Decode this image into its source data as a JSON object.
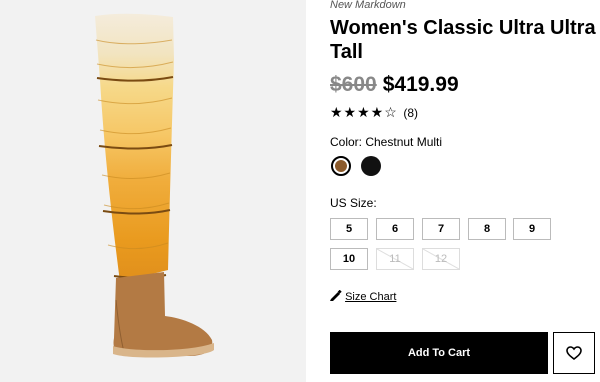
{
  "product": {
    "badge": "New Markdown",
    "title": "Women's Classic Ultra Ultra Tall",
    "price_original": "$600",
    "price_sale": "$419.99",
    "rating": 4,
    "rating_max": 5,
    "stars_display": "★★★★☆",
    "review_count": "(8)"
  },
  "colors": {
    "label": "Color: Chestnut Multi",
    "options": [
      {
        "name": "Chestnut Multi",
        "hex": "#8b5a2b",
        "selected": true
      },
      {
        "name": "Black",
        "hex": "#111111",
        "selected": false
      }
    ]
  },
  "sizes": {
    "label": "US Size:",
    "options": [
      {
        "label": "5",
        "available": true
      },
      {
        "label": "6",
        "available": true
      },
      {
        "label": "7",
        "available": true
      },
      {
        "label": "8",
        "available": true
      },
      {
        "label": "9",
        "available": true
      },
      {
        "label": "10",
        "available": true
      },
      {
        "label": "11",
        "available": false
      },
      {
        "label": "12",
        "available": false
      }
    ]
  },
  "links": {
    "size_chart": "Size Chart"
  },
  "actions": {
    "add_to_cart": "Add To Cart",
    "wishlist_icon": "heart-icon"
  },
  "icons": {
    "size_chart": "ruler-pencil-icon"
  }
}
